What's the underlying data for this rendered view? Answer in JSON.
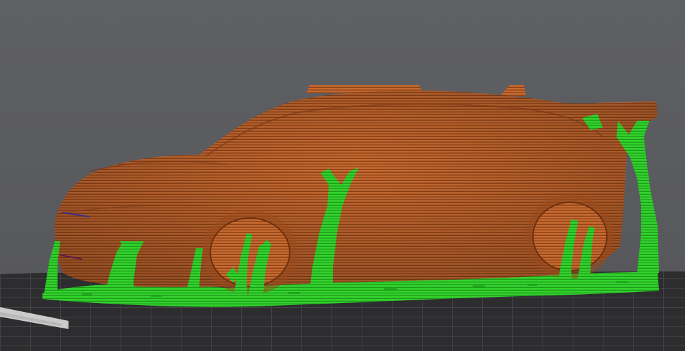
{
  "app": {
    "view": "3d-preview",
    "colors": {
      "background": "#5a5b5f",
      "bed": "#2c2c2e",
      "bed_grid": "#6a6a6c",
      "model": "#c0632b",
      "model_dark": "#8a3c14",
      "support": "#2fc52a",
      "support_dark": "#1b8d18",
      "bed_label": "#e8e8e8"
    },
    "icons": [
      "build-plate",
      "car-model",
      "support-structure"
    ]
  }
}
